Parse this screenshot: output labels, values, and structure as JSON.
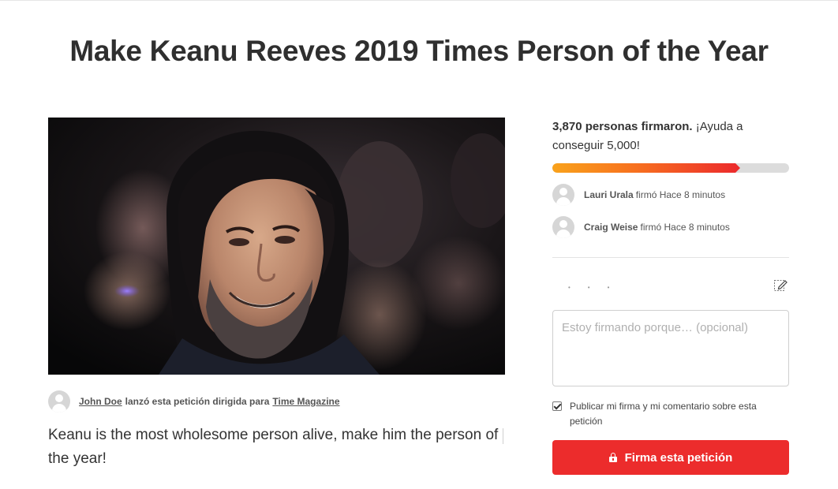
{
  "petition": {
    "title": "Make Keanu Reeves 2019 Times Person of the Year",
    "starter_name": "John Doe",
    "starter_text": "lanzó esta petición dirigida para",
    "target": "Time Magazine",
    "description": "Keanu is the most wholesome person alive, make him the person of the year!"
  },
  "signatures": {
    "count_text": "3,870 personas firmaron.",
    "goal_text": "¡Ayuda a conseguir 5,000!",
    "progress_fraction": 0.774,
    "recent": [
      {
        "name": "Lauri Urala",
        "action": "firmó Hace 8 minutos"
      },
      {
        "name": "Craig Weise",
        "action": "firmó Hace 8 minutos"
      }
    ]
  },
  "form": {
    "comment_placeholder": "Estoy firmando porque… (opcional)",
    "publish_label": "Publicar mi firma y mi comentario sobre esta petición",
    "publish_checked": true,
    "sign_button": "Firma esta petición"
  },
  "icons": {
    "edit": "edit-icon",
    "lock": "lock-icon",
    "avatar": "user-avatar-icon",
    "checkbox": "checkbox-checked-icon"
  },
  "colors": {
    "accent": "#ec2c2c",
    "progress_start": "#f9a21b",
    "progress_end": "#ec2c2c",
    "progress_track": "#dcdcdc"
  }
}
